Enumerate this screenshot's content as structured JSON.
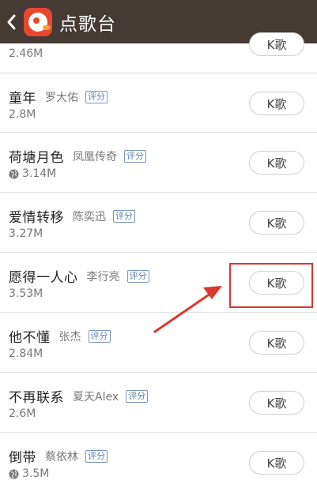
{
  "header": {
    "title": "点歌台",
    "background": "#453a34"
  },
  "list": {
    "partial_top": {
      "size": "2.46M",
      "button": "K歌"
    },
    "items": [
      {
        "song": "童年",
        "artist": "罗大佑",
        "tag": "评分",
        "size": "2.8M",
        "has_globe": false,
        "button": "K歌"
      },
      {
        "song": "荷塘月色",
        "artist": "凤凰传奇",
        "tag": "评分",
        "size": "3.14M",
        "has_globe": true,
        "button": "K歌"
      },
      {
        "song": "爱情转移",
        "artist": "陈奕迅",
        "tag": "评分",
        "size": "3.27M",
        "has_globe": false,
        "button": "K歌"
      },
      {
        "song": "愿得一人心",
        "artist": "李行亮",
        "tag": "评分",
        "size": "3.53M",
        "has_globe": false,
        "button": "K歌"
      },
      {
        "song": "他不懂",
        "artist": "张杰",
        "tag": "评分",
        "size": "2.84M",
        "has_globe": false,
        "button": "K歌"
      },
      {
        "song": "不再联系",
        "artist": "夏天Alex",
        "tag": "评分",
        "size": "2.6M",
        "has_globe": false,
        "button": "K歌"
      },
      {
        "song": "倒带",
        "artist": "蔡依林",
        "tag": "评分",
        "size": "3.5M",
        "has_globe": true,
        "button": "K歌"
      }
    ]
  },
  "annotation": {
    "color": "#d9372f"
  },
  "icons": {
    "back": "chevron-left-icon",
    "logo": "app-logo-icon",
    "globe": "globe-icon"
  }
}
